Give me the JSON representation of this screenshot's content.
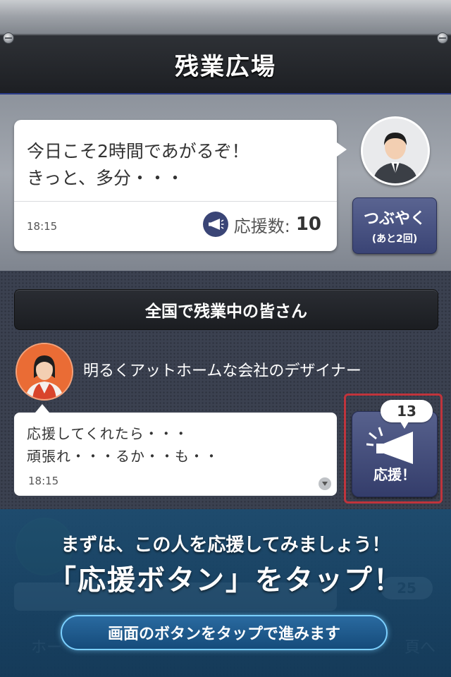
{
  "header": {
    "title": "残業広場"
  },
  "my_tweet": {
    "lines": [
      "今日こそ2時間であがるぞ！",
      "きっと、多分・・・"
    ],
    "time": "18:15",
    "cheer_label": "応援数:",
    "cheer_count": "10"
  },
  "tweet_button": {
    "label": "つぶやく",
    "sub": "(あと2回)"
  },
  "section": {
    "title": "全国で残業中の皆さん"
  },
  "users": [
    {
      "description": "明るくアットホームな会社のデザイナー",
      "lines": [
        "応援してくれたら・・・",
        "頑張れ・・・るか・・も・・"
      ],
      "time": "18:15",
      "cheer_count": "13",
      "cheer_label": "応援！"
    },
    {
      "cheer_count": "25"
    }
  ],
  "background_nav": {
    "home_partial": "ホー",
    "next_partial": "頁へ"
  },
  "tutorial": {
    "line1": "まずは、この人を応援してみましょう！",
    "line2": "「応援ボタン」をタップ！",
    "proceed_label": "画面のボタンをタップで進みます"
  },
  "colors": {
    "navy_button": "#3a4475",
    "alert_frame": "#c0343c",
    "overlay": "#1c4c70",
    "overlay_border": "#7bd0ff",
    "female_avatar": "#ea6c35"
  },
  "icons": [
    "megaphone-icon",
    "male-avatar-icon",
    "female-avatar-icon",
    "expand-icon"
  ]
}
